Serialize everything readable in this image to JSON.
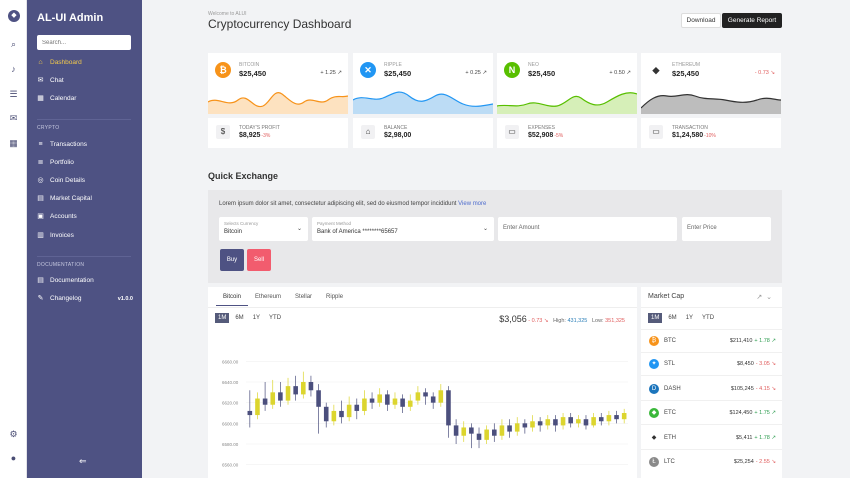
{
  "rail": {
    "icons": [
      "logo-icon",
      "search-icon",
      "bell-icon",
      "sliders-icon",
      "chat-icon",
      "calendar-icon",
      "gear-icon",
      "user-icon"
    ]
  },
  "sidebar": {
    "brand": "AL-UI Admin",
    "search_placeholder": "Search...",
    "items": [
      {
        "label": "Dashboard",
        "icon": "home-icon"
      },
      {
        "label": "Chat",
        "icon": "chat-icon"
      },
      {
        "label": "Calendar",
        "icon": "calendar-icon"
      }
    ],
    "crypto_heading": "CRYPTO",
    "crypto_items": [
      {
        "label": "Transactions",
        "icon": "list-icon"
      },
      {
        "label": "Portfolio",
        "icon": "portfolio-icon"
      },
      {
        "label": "Coin Details",
        "icon": "coin-icon"
      },
      {
        "label": "Market Capital",
        "icon": "chart-icon"
      },
      {
        "label": "Accounts",
        "icon": "accounts-icon"
      },
      {
        "label": "Invoices",
        "icon": "invoice-icon"
      }
    ],
    "docs_heading": "DOCUMENTATION",
    "doc_items": [
      {
        "label": "Documentation",
        "icon": "doc-icon"
      },
      {
        "label": "Changelog",
        "icon": "pencil-icon",
        "badge": "v1.0.0"
      }
    ]
  },
  "header": {
    "welcome": "Welcome to ALUI",
    "title": "Cryptocurrency Dashboard",
    "download": "Download",
    "generate": "Generate Report"
  },
  "coins": [
    {
      "name": "BITCOIN",
      "value": "$25,450",
      "change": "+ 1.25 ↗",
      "color": "#f7931a",
      "up": true
    },
    {
      "name": "RIPPLE",
      "value": "$25,450",
      "change": "+ 0.25 ↗",
      "color": "#2196f3",
      "up": true
    },
    {
      "name": "NEO",
      "value": "$25,450",
      "change": "+ 0.50 ↗",
      "color": "#58bf00",
      "up": true
    },
    {
      "name": "ETHEREUM",
      "value": "$25,450",
      "change": "- 0.73 ↘",
      "color": "#333333",
      "up": false
    }
  ],
  "stats": [
    {
      "label": "TODAY'S PROFIT",
      "value": "$8,925",
      "change": "-3%"
    },
    {
      "label": "BALANCE",
      "value": "$2,98,00",
      "change": ""
    },
    {
      "label": "EXPENSES",
      "value": "$52,908",
      "change": "-5%"
    },
    {
      "label": "TRANSACTION",
      "value": "$1,24,580",
      "change": "-10%"
    }
  ],
  "quick_exchange": {
    "title": "Quick Exchange",
    "description": "Lorem ipsum dolor sit amet, consectetur adipiscing elit, sed do eiusmod tempor incididunt",
    "view_more": "View more",
    "currency_label": "Selects Currency",
    "currency_value": "Bitcoin",
    "payment_label": "Payment Method",
    "payment_value": "Bank of America ********65657",
    "amount_placeholder": "Enter Amount",
    "price_placeholder": "Enter Price",
    "buy": "Buy",
    "sell": "Sell"
  },
  "price_chart": {
    "tabs": [
      "Bitcoin",
      "Ethereum",
      "Stellar",
      "Ripple"
    ],
    "ranges": [
      "1M",
      "6M",
      "1Y",
      "YTD"
    ],
    "price": "$3,056",
    "change": "- 0.73 ↘",
    "high_label": "High:",
    "high": "431,325",
    "low_label": "Low:",
    "low": "351,325",
    "y_ticks": [
      "6660.00",
      "6640.00",
      "6620.00",
      "6600.00",
      "6580.00",
      "6560.00"
    ]
  },
  "chart_data": {
    "type": "candlestick",
    "ylim": [
      6550,
      6670
    ],
    "candles": [
      [
        6612,
        6608,
        6632,
        6596
      ],
      [
        6608,
        6624,
        6630,
        6604
      ],
      [
        6624,
        6618,
        6640,
        6612
      ],
      [
        6618,
        6630,
        6642,
        6614
      ],
      [
        6630,
        6622,
        6640,
        6616
      ],
      [
        6622,
        6636,
        6644,
        6618
      ],
      [
        6636,
        6628,
        6646,
        6622
      ],
      [
        6628,
        6640,
        6650,
        6624
      ],
      [
        6640,
        6632,
        6646,
        6626
      ],
      [
        6632,
        6616,
        6638,
        6590
      ],
      [
        6616,
        6602,
        6620,
        6596
      ],
      [
        6602,
        6612,
        6618,
        6598
      ],
      [
        6612,
        6606,
        6622,
        6600
      ],
      [
        6606,
        6618,
        6626,
        6602
      ],
      [
        6618,
        6612,
        6624,
        6604
      ],
      [
        6612,
        6624,
        6632,
        6608
      ],
      [
        6624,
        6620,
        6630,
        6614
      ],
      [
        6620,
        6628,
        6634,
        6616
      ],
      [
        6628,
        6618,
        6632,
        6612
      ],
      [
        6618,
        6624,
        6630,
        6614
      ],
      [
        6624,
        6616,
        6628,
        6610
      ],
      [
        6616,
        6622,
        6628,
        6612
      ],
      [
        6622,
        6630,
        6636,
        6618
      ],
      [
        6630,
        6626,
        6634,
        6618
      ],
      [
        6626,
        6620,
        6630,
        6614
      ],
      [
        6620,
        6632,
        6638,
        6616
      ],
      [
        6632,
        6598,
        6636,
        6586
      ],
      [
        6598,
        6588,
        6604,
        6580
      ],
      [
        6588,
        6596,
        6602,
        6582
      ],
      [
        6596,
        6590,
        6600,
        6576
      ],
      [
        6590,
        6584,
        6596,
        6576
      ],
      [
        6584,
        6594,
        6598,
        6580
      ],
      [
        6594,
        6588,
        6600,
        6582
      ],
      [
        6588,
        6598,
        6604,
        6584
      ],
      [
        6598,
        6592,
        6604,
        6586
      ],
      [
        6592,
        6600,
        6606,
        6588
      ],
      [
        6600,
        6596,
        6604,
        6590
      ],
      [
        6596,
        6602,
        6608,
        6592
      ],
      [
        6602,
        6598,
        6606,
        6592
      ],
      [
        6598,
        6604,
        6608,
        6594
      ],
      [
        6604,
        6598,
        6608,
        6592
      ],
      [
        6598,
        6606,
        6610,
        6594
      ],
      [
        6606,
        6600,
        6610,
        6596
      ],
      [
        6600,
        6604,
        6608,
        6596
      ],
      [
        6604,
        6598,
        6608,
        6594
      ],
      [
        6598,
        6606,
        6610,
        6596
      ],
      [
        6606,
        6602,
        6610,
        6598
      ],
      [
        6602,
        6608,
        6612,
        6598
      ],
      [
        6608,
        6604,
        6612,
        6600
      ],
      [
        6604,
        6610,
        6614,
        6600
      ]
    ]
  },
  "market_cap": {
    "title": "Market Cap",
    "ranges": [
      "1M",
      "6M",
      "1Y",
      "YTD"
    ],
    "rows": [
      {
        "sym": "BTC",
        "price": "$211,410",
        "change": "+ 1.78 ↗",
        "up": true,
        "color": "#f7931a"
      },
      {
        "sym": "STL",
        "price": "$8,450",
        "change": "- 3.05 ↘",
        "up": false,
        "color": "#2196f3"
      },
      {
        "sym": "DASH",
        "price": "$105,245",
        "change": "- 4.15 ↘",
        "up": false,
        "color": "#1c75bc"
      },
      {
        "sym": "ETC",
        "price": "$124,450",
        "change": "+ 1.75 ↗",
        "up": true,
        "color": "#3ab83a"
      },
      {
        "sym": "ETH",
        "price": "$5,411",
        "change": "+ 1.78 ↗",
        "up": true,
        "color": "#555555"
      },
      {
        "sym": "LTC",
        "price": "$25,254",
        "change": "- 2.55 ↘",
        "up": false,
        "color": "#8a8a8a"
      }
    ]
  }
}
